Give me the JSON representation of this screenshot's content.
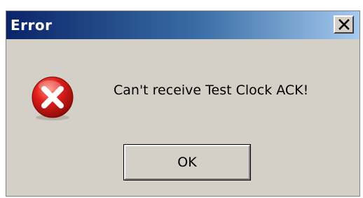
{
  "window": {
    "title": "Error",
    "close_icon": "close-icon"
  },
  "body": {
    "icon": "error-icon",
    "message": "Can't receive Test Clock ACK!"
  },
  "buttons": {
    "ok_label": "OK"
  },
  "colors": {
    "title_bar_start": "#0a246a",
    "title_bar_end": "#a6caf0",
    "dialog_background": "#d4d0c8",
    "error_red": "#e0201c"
  }
}
